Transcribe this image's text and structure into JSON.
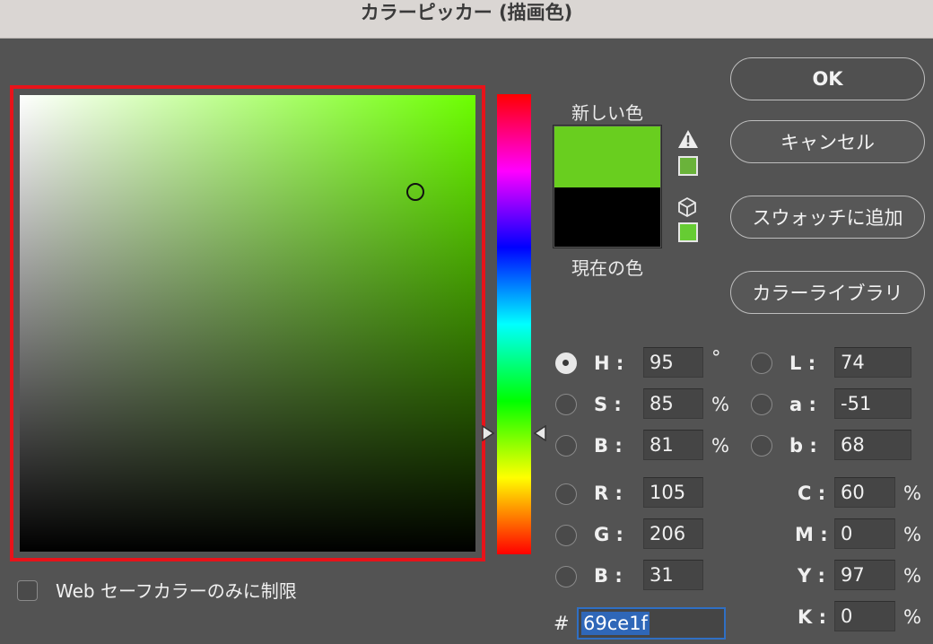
{
  "window": {
    "title": "カラーピッカー (描画色)"
  },
  "colors": {
    "new_color": "#69ce1f",
    "current_color": "#000000",
    "field_hue": "#6cff00",
    "highlight_border": "#e8131a"
  },
  "swatches": {
    "new_label": "新しい色",
    "current_label": "現在の色"
  },
  "icons": {
    "gamut_warning": "warning-triangle-icon",
    "web_safe": "cube-icon"
  },
  "buttons": {
    "ok": "OK",
    "cancel": "キャンセル",
    "add_to_swatches": "スウォッチに追加",
    "color_libraries": "カラーライブラリ"
  },
  "hsb": {
    "h": {
      "label": "H :",
      "value": "95",
      "unit": "°",
      "selected": true
    },
    "s": {
      "label": "S :",
      "value": "85",
      "unit": "%"
    },
    "b": {
      "label": "B :",
      "value": "81",
      "unit": "%"
    }
  },
  "lab": {
    "l": {
      "label": "L :",
      "value": "74"
    },
    "a": {
      "label": "a :",
      "value": "-51"
    },
    "b": {
      "label": "b :",
      "value": "68"
    }
  },
  "rgb": {
    "r": {
      "label": "R :",
      "value": "105"
    },
    "g": {
      "label": "G :",
      "value": "206"
    },
    "b": {
      "label": "B :",
      "value": "31"
    }
  },
  "cmyk": {
    "c": {
      "label": "C :",
      "value": "60",
      "unit": "%"
    },
    "m": {
      "label": "M :",
      "value": "0",
      "unit": "%"
    },
    "y": {
      "label": "Y :",
      "value": "97",
      "unit": "%"
    },
    "k": {
      "label": "K :",
      "value": "0",
      "unit": "%"
    }
  },
  "hex": {
    "label": "#",
    "value": "69ce1f"
  },
  "web_safe_only": {
    "label": "Web セーフカラーのみに制限",
    "checked": false
  }
}
